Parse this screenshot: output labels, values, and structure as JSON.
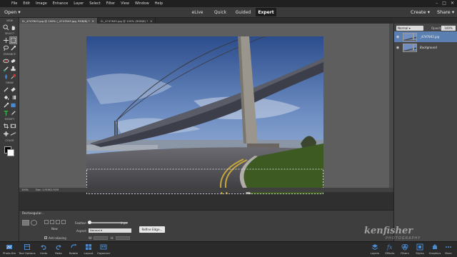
{
  "menu": [
    "File",
    "Edit",
    "Image",
    "Enhance",
    "Layer",
    "Select",
    "Filter",
    "View",
    "Window",
    "Help"
  ],
  "window_controls": [
    "–",
    "□",
    "✕"
  ],
  "topbar": {
    "open_label": "Open",
    "modes": [
      "eLive",
      "Quick",
      "Guided",
      "Expert"
    ],
    "active_mode": "Expert",
    "create_label": "Create",
    "share_label": "Share"
  },
  "tools": {
    "groups": [
      "VIEW",
      "SELECT",
      "ENHANCE",
      "DRAW",
      "MODIFY",
      "COLOR"
    ],
    "foreground_color": "#000000",
    "background_color": "#ffffff"
  },
  "doc_tabs": [
    {
      "label": "D:_4747843.jpg @ 100% (_4747843.jpg, RGB/8) *",
      "active": true
    },
    {
      "label": "D:_4747845.jpg @ 100% (RGB/8) *",
      "active": false
    }
  ],
  "status": {
    "zoom": "100%",
    "doc_size": "Doc: 1.91M/1.91M"
  },
  "layers_panel": {
    "blend_mode": "Normal",
    "opacity_label": "Opacity:",
    "opacity_value": "100%",
    "layers": [
      {
        "name": "_4747843.jpg",
        "active": true
      },
      {
        "name": "Background",
        "active": false
      }
    ]
  },
  "tool_options": {
    "title": "Rectangular...",
    "new_label": "New",
    "anti_alias_label": "Anti-aliasing",
    "feather_label": "Feather:",
    "feather_value": "0 px",
    "aspect_label": "Aspect:",
    "aspect_value": "Normal",
    "w_label": "W:",
    "h_label": "H:",
    "refine_label": "Refine Edge..."
  },
  "bottom_left": [
    {
      "label": "Photo Bin",
      "icon": "photo-bin-icon"
    },
    {
      "label": "Tool Options",
      "icon": "tool-options-icon"
    },
    {
      "label": "Undo",
      "icon": "undo-icon"
    },
    {
      "label": "Redo",
      "icon": "redo-icon"
    },
    {
      "label": "Rotate",
      "icon": "rotate-icon"
    },
    {
      "label": "Layout",
      "icon": "layout-icon"
    },
    {
      "label": "Organizer",
      "icon": "organizer-icon"
    }
  ],
  "bottom_right": [
    {
      "label": "Layers",
      "icon": "layers-icon"
    },
    {
      "label": "Effects",
      "icon": "effects-icon"
    },
    {
      "label": "Filters",
      "icon": "filters-icon"
    },
    {
      "label": "Styles",
      "icon": "styles-icon"
    },
    {
      "label": "Graphics",
      "icon": "graphics-icon"
    },
    {
      "label": "More",
      "icon": "more-icon"
    }
  ],
  "watermark": {
    "main": "kenfisher",
    "sub": "PHOTOGRAPHY"
  },
  "colors": {
    "accent": "#5a7fb0",
    "canvas_bg": "#5e5e5e",
    "panel_bg": "#3b3b3b"
  }
}
